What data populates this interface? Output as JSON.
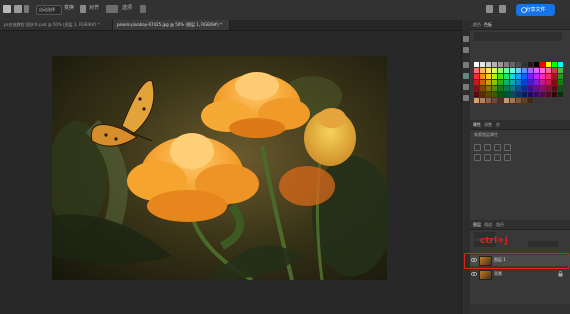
{
  "topbar": {
    "mode_label": "变换",
    "align_label": "对齐",
    "option_label": "自动选择",
    "zoom_label": "选项",
    "share_label": "分享文件"
  },
  "tabs": [
    {
      "label": "ps合成教程 国庆节.psd @ 50% (图层 1, RGB/8#) *",
      "active": false
    },
    {
      "label": "pexels-pixabay-67425.jpg @ 50% (图层 1, RGB/8#) *",
      "active": true
    }
  ],
  "panels": {
    "color_tabs": [
      "颜色",
      "色板"
    ],
    "properties_tabs": [
      "属性",
      "调整",
      "库"
    ],
    "properties_title": "像素图层属性",
    "layers_tabs": [
      "图层",
      "通道",
      "路径"
    ],
    "annotation": "ctrl+j"
  },
  "layers": [
    {
      "name": "图层 1",
      "selected": true
    },
    {
      "name": "背景",
      "selected": false
    }
  ],
  "colors": {
    "accent": "#1473e6",
    "highlight_box": "#e0221c",
    "annotation": "#e0221c"
  },
  "icons": [
    "home-icon",
    "move-tool-icon",
    "share-icon",
    "eye-icon",
    "lock-icon"
  ]
}
